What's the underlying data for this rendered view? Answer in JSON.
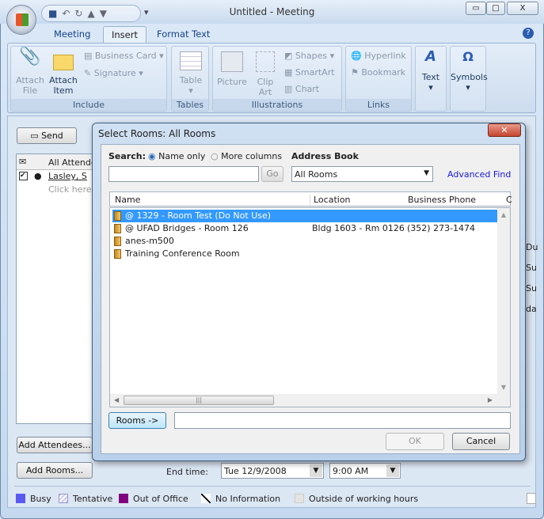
{
  "window": {
    "title": "Untitled - Meeting",
    "minimize": "▭",
    "maximize": "□",
    "close": "X"
  },
  "ribbon": {
    "tabs": [
      {
        "label": "Meeting"
      },
      {
        "label": "Insert"
      },
      {
        "label": "Format Text"
      }
    ],
    "help": "?",
    "groups": {
      "include": {
        "label": "Include",
        "attach_file": "Attach File",
        "attach_item": "Attach Item",
        "business_card": "Business Card",
        "signature": "Signature"
      },
      "tables": {
        "label": "Tables",
        "table": "Table"
      },
      "illustrations": {
        "label": "Illustrations",
        "picture": "Picture",
        "clip_art": "Clip Art",
        "shapes": "Shapes",
        "smartart": "SmartArt",
        "chart": "Chart"
      },
      "links": {
        "label": "Links",
        "hyperlink": "Hyperlink",
        "bookmark": "Bookmark"
      },
      "text": {
        "label": "Text"
      },
      "symbols": {
        "label": "Symbols"
      }
    }
  },
  "meeting": {
    "send": "Send",
    "grid_header": "All Attendees",
    "attendee": "Lasley, S",
    "click_here": "Click here t",
    "add_attendees": "Add Attendees...",
    "add_rooms": "Add Rooms...",
    "end_time_label": "End time:",
    "end_date": "Tue 12/9/2008",
    "end_time": "9:00 AM",
    "right_labels": [
      "Du",
      "Su",
      "Su da"
    ]
  },
  "legend": [
    {
      "label": "Busy",
      "color": "#5b5bef"
    },
    {
      "label": "Tentative",
      "color": "#c8c8f5"
    },
    {
      "label": "Out of Office",
      "color": "#800080"
    },
    {
      "label": "No Information",
      "color": "#ffffff"
    },
    {
      "label": "Outside of working hours",
      "color": "#e3e3e3"
    }
  ],
  "dialog": {
    "title": "Select Rooms: All Rooms",
    "search_label": "Search:",
    "radio_name_only": "Name only",
    "radio_more_columns": "More columns",
    "search_value": "",
    "go": "Go",
    "address_book_label": "Address Book",
    "address_book_value": "All Rooms",
    "advanced_find": "Advanced Find",
    "columns": [
      "Name",
      "Location",
      "Business Phone",
      "C"
    ],
    "rows": [
      {
        "name": "@ 1329 - Room Test (Do Not Use)",
        "location": "",
        "phone": "",
        "selected": true
      },
      {
        "name": "@ UFAD Bridges - Room 126",
        "location": "Bldg 1603 - Rm 0126",
        "phone": "(352) 273-1474",
        "selected": false
      },
      {
        "name": "anes-m500",
        "location": "",
        "phone": "",
        "selected": false
      },
      {
        "name": "Training Conference Room",
        "location": "",
        "phone": "",
        "selected": false
      }
    ],
    "rooms_button": "Rooms ->",
    "rooms_value": "",
    "ok": "OK",
    "cancel": "Cancel"
  }
}
